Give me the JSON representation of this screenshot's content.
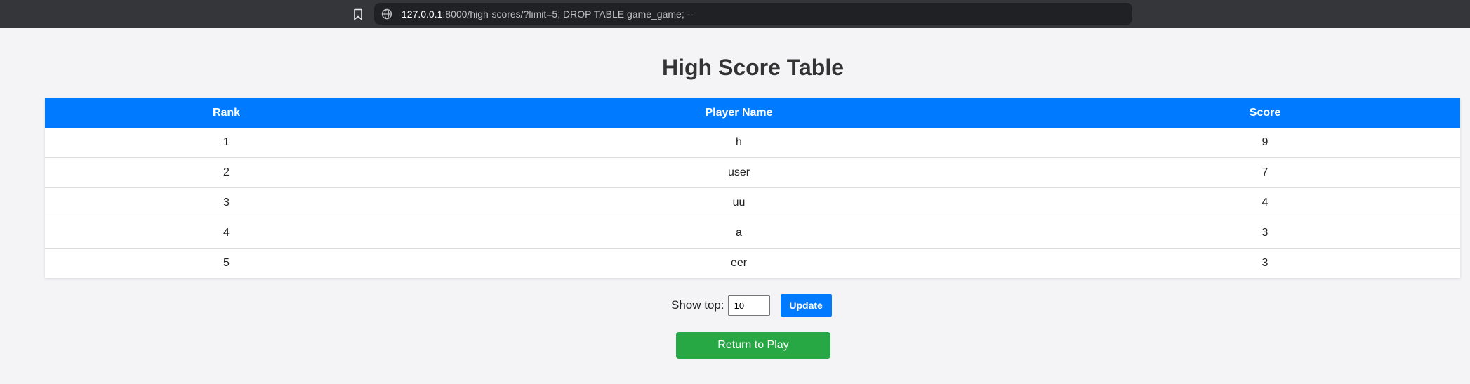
{
  "browser": {
    "url_host": "127.0.0.1",
    "url_rest": ":8000/high-scores/?limit=5; DROP TABLE game_game; --"
  },
  "page": {
    "title": "High Score Table"
  },
  "table": {
    "headers": [
      "Rank",
      "Player Name",
      "Score"
    ],
    "rows": [
      [
        "1",
        "h",
        "9"
      ],
      [
        "2",
        "user",
        "7"
      ],
      [
        "3",
        "uu",
        "4"
      ],
      [
        "4",
        "a",
        "3"
      ],
      [
        "5",
        "eer",
        "3"
      ]
    ]
  },
  "controls": {
    "show_top_label": "Show top:",
    "limit_value": "10",
    "update_label": "Update",
    "return_label": "Return to Play"
  },
  "colors": {
    "header_blue": "#007bff",
    "return_green": "#28a745",
    "browser_chrome": "#35363a"
  },
  "icons": {
    "bookmark": "bookmark-icon",
    "site_info": "site-info-icon"
  }
}
